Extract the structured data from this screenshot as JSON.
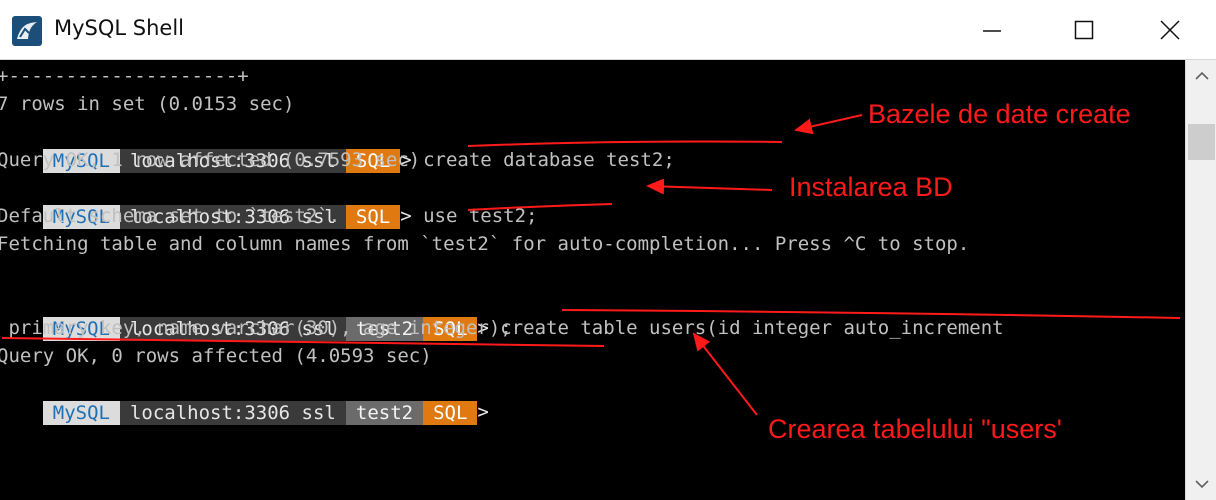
{
  "window": {
    "title": "MySQL Shell",
    "controls": {
      "minimize": "minimize-icon",
      "maximize": "maximize-icon",
      "close": "close-icon"
    }
  },
  "prompt": {
    "mysql": "MySQL",
    "host": "localhost:3306 ssl",
    "db": "test2",
    "mode": "SQL",
    "arrow": ">"
  },
  "console": {
    "lines": [
      "+--------------------+",
      "7 rows in set (0.0153 sec)",
      "",
      "Query OK, 1 row affected (0.7593 sec)",
      "",
      "Default schema set to `test2`.",
      "Fetching table and column names from `test2` for auto-completion... Press ^C to stop.",
      "",
      "",
      " primary key, name varchar(30), age integer);",
      "Query OK, 0 rows affected (4.0593 sec)",
      ""
    ],
    "commands": {
      "create_db": " create database test2;",
      "use_db": " use test2;",
      "create_table": " create table users(id integer auto_increment"
    }
  },
  "annotations": {
    "db_created": "Bazele de date create",
    "db_install": "Instalarea BD",
    "table_created": "Crearea tabelului \"users'"
  },
  "colors": {
    "terminal_bg": "#000000",
    "terminal_text": "#c0c0c0",
    "mysql_seg": "#dcdcdc",
    "host_seg": "#3a3a3a",
    "db_seg": "#6b6b6b",
    "sql_seg": "#e07a10",
    "annotation": "#ff1a1a"
  }
}
